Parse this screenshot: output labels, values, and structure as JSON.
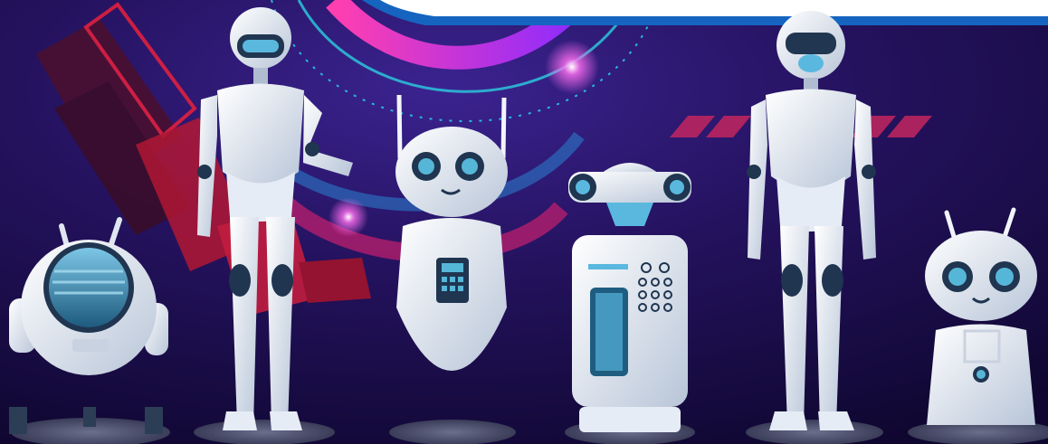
{
  "scene": {
    "description_colors": {
      "background_deep": "#120838",
      "background_mid": "#2a1763",
      "accent_red": "#d81e3a",
      "accent_magenta": "#e23bd8",
      "accent_cyan": "#29c6e8",
      "banner_blue": "#1565c0",
      "robot_white": "#eef2f8",
      "robot_shade": "#b9c4d6",
      "robot_dark": "#1f3550",
      "visor": "#3f8fb8",
      "eye_blue": "#2aa6d8"
    },
    "robots": [
      {
        "name": "round-visor-robot",
        "icon": "robot-icon"
      },
      {
        "name": "female-android-thumbs-up",
        "icon": "robot-icon"
      },
      {
        "name": "cute-antenna-robot",
        "icon": "robot-icon"
      },
      {
        "name": "kiosk-robot",
        "icon": "robot-icon"
      },
      {
        "name": "tall-android",
        "icon": "robot-icon"
      },
      {
        "name": "small-antenna-robot",
        "icon": "robot-icon"
      }
    ]
  }
}
